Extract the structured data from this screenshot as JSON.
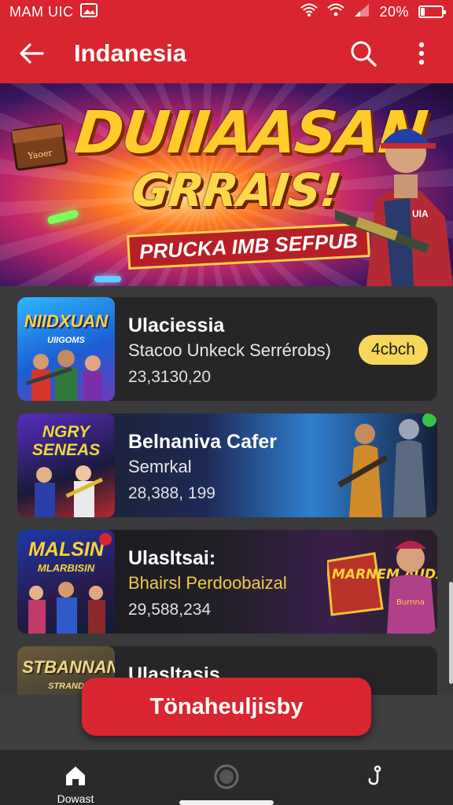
{
  "status_bar": {
    "left_text": "MAM UIC",
    "battery": "20%",
    "battery_level": 0.2
  },
  "app_bar": {
    "title": "Indanesia",
    "icons": [
      "back-arrow-icon",
      "search-icon",
      "more-vert-icon"
    ]
  },
  "banner": {
    "headline": "DUIIAASAN",
    "headline2": "GRRAIS!",
    "ribbon": "PRUCKA IMB SEFPUB",
    "chest_text": "Yaoer"
  },
  "cards": [
    {
      "thumb_title": "NIIDXUAN",
      "thumb_sub": "UIIGOMS",
      "name": "Ulaciessia",
      "subtitle": "Stacoo Unkeck Serrérobs)",
      "number": "23,3130,20",
      "pill": "4cbch"
    },
    {
      "thumb_title": "NGRY SENEAS",
      "name": "Belnaniva Cafer",
      "subtitle": "Semrkal",
      "number": "28,388, 199"
    },
    {
      "thumb_title": "MALSIN",
      "thumb_sub": "MLARBISIN",
      "name": "Ulasltsai:",
      "subtitle": "Bhairsl Perdoobaizal",
      "number": "29,588,234",
      "art_text": "MARNEM AUDXEN",
      "shirt_text": "Burnna"
    },
    {
      "thumb_title": "STBANNAN",
      "thumb_sub": "STRAND",
      "name": "Ulasltasis"
    }
  ],
  "fab": {
    "label": "Tönaheuljisby"
  },
  "navbar": {
    "items": [
      {
        "label": "Dowast",
        "icon": "home-icon"
      },
      {
        "label": "",
        "icon": "record-circle-icon"
      },
      {
        "label": "",
        "icon": "hook-icon"
      }
    ]
  },
  "colors": {
    "primary": "#d9252f",
    "pill": "#f6d75a",
    "card_bg": "#262628",
    "list_bg": "#3a3a3c",
    "nav_bg": "#2a2a2c"
  }
}
